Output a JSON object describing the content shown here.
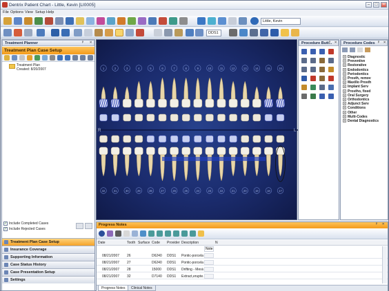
{
  "window": {
    "title": "Dentrix Patient Chart - Little, Kevin [LI0005]"
  },
  "menu": [
    "File",
    "Options",
    "View",
    "Setup",
    "Help"
  ],
  "toolbar": {
    "patient_combo": "Little, Kevin",
    "provider_combo": "DDS1"
  },
  "treatment_planner": {
    "title": "Treatment Planner",
    "section": "Treatment Plan Case Setup",
    "tree": {
      "node": "Treatment Plan",
      "created": "Created: 8/20/2007"
    },
    "checks": [
      "Include Completed Cases",
      "Include Rejected Cases"
    ],
    "nav": [
      "Treatment Plan Case Setup",
      "Insurance Coverage",
      "Supporting Information",
      "Case Status History",
      "Case Presentation Setup",
      "Settings"
    ]
  },
  "chart": {
    "upper_numbers": [
      "1",
      "2",
      "3",
      "4",
      "5",
      "6",
      "7",
      "8",
      "9",
      "10",
      "11",
      "12",
      "13",
      "14",
      "15",
      "16"
    ],
    "lower_numbers": [
      "32",
      "31",
      "30",
      "29",
      "28",
      "27",
      "26",
      "25",
      "24",
      "23",
      "22",
      "21",
      "20",
      "19",
      "18",
      "17"
    ],
    "side_left": "R",
    "side_right": "L"
  },
  "procedure_buttons": {
    "title": "Procedure Butt..."
  },
  "procedure_codes": {
    "title": "Procedure Codes",
    "items": [
      "Diagnostic",
      "Preventive",
      "Restorative",
      "Endodontics",
      "Periodontics",
      "Prosth, remov",
      "Maxillo Prosth",
      "Implant Serv",
      "Prostho, fixed",
      "Oral Surgery",
      "Orthodontics",
      "Adjunct Serv",
      "Conditions",
      "Other",
      "Multi-Codes",
      "Dental Diagnostics"
    ]
  },
  "progress_notes": {
    "title": "Progress Notes",
    "columns": [
      "Date",
      "Tooth",
      "Surface",
      "Code",
      "Provider",
      "Description",
      "Note",
      "N"
    ],
    "rows": [
      {
        "date": "08/21/2007",
        "tooth": "26",
        "surface": "",
        "code": "D6240",
        "provider": "DDS1",
        "desc": "Pontic-porcela..."
      },
      {
        "date": "08/21/2007",
        "tooth": "27",
        "surface": "",
        "code": "D6240",
        "provider": "DDS1",
        "desc": "Pontic-porcela..."
      },
      {
        "date": "08/21/2007",
        "tooth": "28",
        "surface": "",
        "code": "15000",
        "provider": "DDS1",
        "desc": "Drifting - Mesial"
      },
      {
        "date": "08/21/2007",
        "tooth": "32",
        "surface": "",
        "code": "D7140",
        "provider": "DDS1",
        "desc": "Extract,erupte..."
      }
    ],
    "tabs": [
      "Progress Notes",
      "Clinical Notes"
    ]
  }
}
